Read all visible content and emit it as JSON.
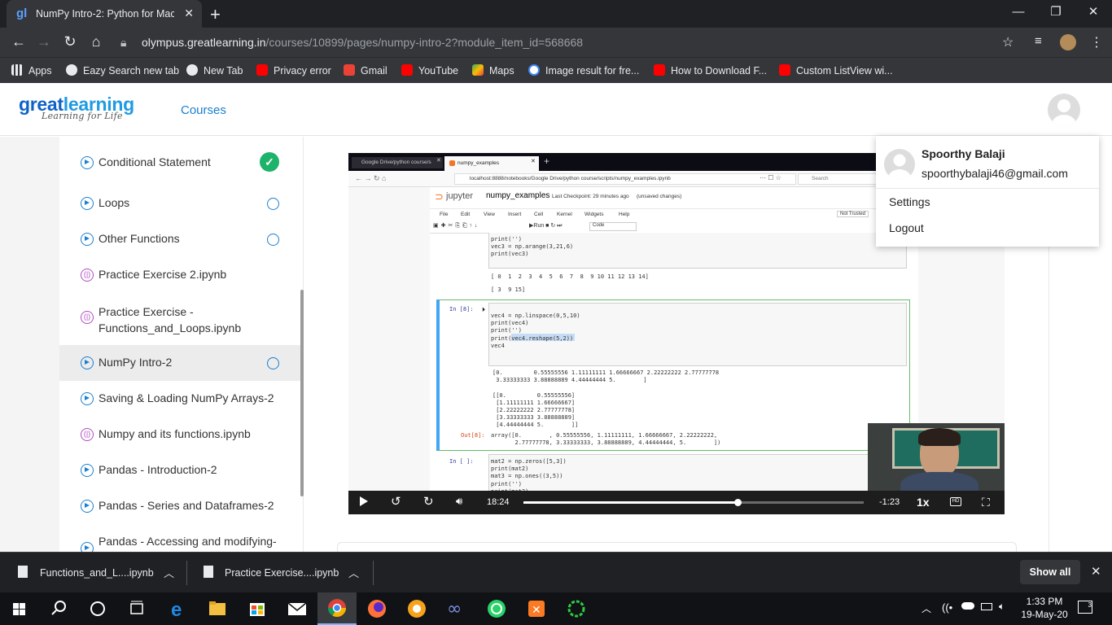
{
  "browser": {
    "tab_title": "NumPy Intro-2: Python for Machine",
    "url_host": "olympus.greatlearning.in",
    "url_path": "/courses/10899/pages/numpy-intro-2?module_item_id=568668",
    "bookmarks": [
      "Apps",
      "Eazy Search new tab",
      "New Tab",
      "Privacy error",
      "Gmail",
      "YouTube",
      "Maps",
      "Image result for fre...",
      "How to Download F...",
      "Custom ListView wi..."
    ]
  },
  "header": {
    "logo_main_1": "great",
    "logo_main_2": "learning",
    "logo_tagline": "Learning for Life",
    "nav_courses": "Courses"
  },
  "sidebar": {
    "items": [
      {
        "label": "Conditional Statement",
        "type": "video",
        "status": "complete"
      },
      {
        "label": "Loops",
        "type": "video",
        "status": "incomplete"
      },
      {
        "label": "Other Functions",
        "type": "video",
        "status": "incomplete"
      },
      {
        "label": "Practice Exercise 2.ipynb",
        "type": "notebook",
        "status": "none"
      },
      {
        "label": "Practice Exercise - Functions_and_Loops.ipynb",
        "type": "notebook",
        "status": "none"
      },
      {
        "label": "NumPy Intro-2",
        "type": "video",
        "status": "incomplete",
        "active": true
      },
      {
        "label": "Saving & Loading NumPy Arrays-2",
        "type": "video",
        "status": "none"
      },
      {
        "label": "Numpy and its functions.ipynb",
        "type": "notebook",
        "status": "none"
      },
      {
        "label": "Pandas - Introduction-2",
        "type": "video",
        "status": "none"
      },
      {
        "label": "Pandas - Series and Dataframes-2",
        "type": "video",
        "status": "none"
      },
      {
        "label": "Pandas - Accessing and modifying-",
        "type": "video",
        "status": "none"
      }
    ]
  },
  "video": {
    "inner_tabs": [
      "Google Drive/python course/s",
      "numpy_examples"
    ],
    "inner_url": "localhost:8888/notebooks/Google Drive/python course/scripts/numpy_examples.ipynb",
    "inner_search": "Search",
    "jupyter_brand": "jupyter",
    "notebook_name": "numpy_examples",
    "checkpoint": "Last Checkpoint: 29 minutes ago",
    "unsaved": "(unsaved changes)",
    "menu": [
      "File",
      "Edit",
      "View",
      "Insert",
      "Cell",
      "Kernel",
      "Widgets",
      "Help"
    ],
    "not_trusted": "Not Trusted",
    "toolbar_run": "Run",
    "toolbar_celltype": "Code",
    "code_top": "print('')\nvec3 = np.arange(3,21,6)\nprint(vec3)",
    "out_top1": "[ 0  1  2  3  4  5  6  7  8  9 10 11 12 13 14]",
    "out_top2": "[ 3  9 15]",
    "prompt_in8": "In [8]:",
    "code_in8": "vec4 = np.linspace(0,5,10)\nprint(vec4)\nprint('')\nprint(vec4.reshape(5,2))\nvec4",
    "out_in8": "[0.         0.55555556 1.11111111 1.66666667 2.22222222 2.77777778\n 3.33333333 3.88888889 4.44444444 5.        ]\n\n[[0.         0.55555556]\n [1.11111111 1.66666667]\n [2.22222222 2.77777778]\n [3.33333333 3.88888889]\n [4.44444444 5.        ]]",
    "prompt_out8": "Out[8]:",
    "code_out8": "array([0.        , 0.55555556, 1.11111111, 1.66666667, 2.22222222,\n       2.77777778, 3.33333333, 3.88888889, 4.44444444, 5.        ])",
    "prompt_in_empty": "In [ ]:",
    "code_in_empty": "mat2 = np.zeros([5,3])\nprint(mat2)\nmat3 = np.ones((3,5))\nprint('')\nprint(mat3)\nmat4 = np.eye(5)",
    "current_time": "18:24",
    "remaining_time": "-1:23",
    "speed": "1x",
    "progress": 0.63
  },
  "user_menu": {
    "name": "Spoorthy Balaji",
    "email": "spoorthybalaji46@gmail.com",
    "settings": "Settings",
    "logout": "Logout"
  },
  "downloads": {
    "items": [
      "Functions_and_L....ipynb",
      "Practice Exercise....ipynb"
    ],
    "show_all": "Show all"
  },
  "taskbar": {
    "time": "1:33 PM",
    "date": "19-May-20",
    "notifications": "3"
  }
}
